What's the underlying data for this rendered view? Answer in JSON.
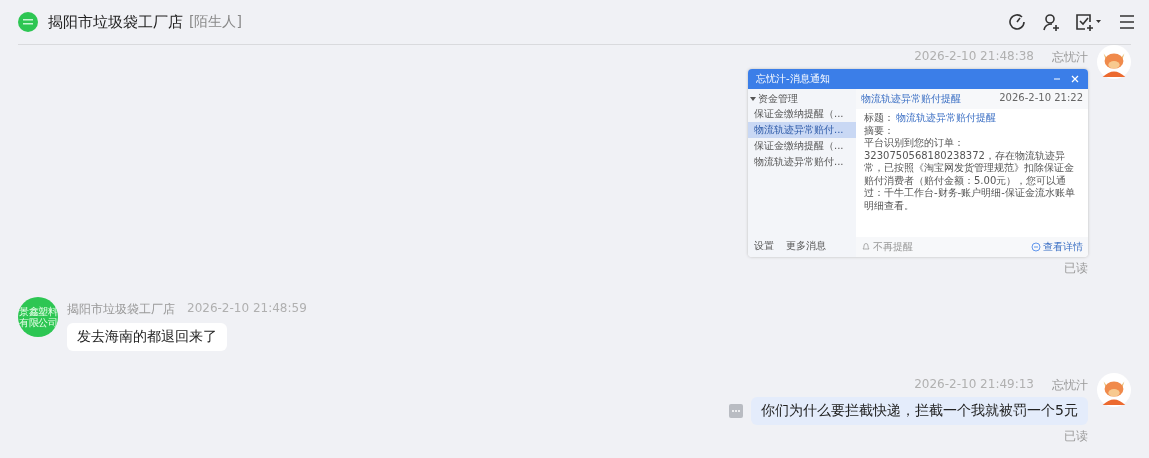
{
  "header": {
    "title": "揭阳市垃圾袋工厂店",
    "tag": "[陌生人]"
  },
  "messages": [
    {
      "outgoing": true,
      "kind": "screenshot",
      "sender": "忘忧汁",
      "time": "2026-2-10 21:48:38",
      "status": "已读",
      "screenshot": {
        "window_title": "忘忧汁-消息通知",
        "tree": {
          "label": "资金管理",
          "expanded": true,
          "children": [
            {
              "label": "保证金缴纳提醒（...",
              "selected": false
            },
            {
              "label": "物流轨迹异常赔付...",
              "selected": true
            },
            {
              "label": "保证金缴纳提醒（...",
              "selected": false
            },
            {
              "label": "物流轨迹异常赔付...",
              "selected": false
            }
          ]
        },
        "notice_title": "物流轨迹异常赔付提醒",
        "notice_time": "2026-2-10 21:22",
        "title_label": "标题：",
        "title_value": "物流轨迹异常赔付提醒",
        "summary_label": "摘要：",
        "summary": "平台识别到您的订单：3230750568180238372，存在物流轨迹异常，已按照《淘宝网发货管理规范》扣除保证金赔付消费者（赔付金额：5.00元），您可以通过：千牛工作台-财务-账户明细-保证金流水账单明细查看。",
        "footer_left": [
          "设置",
          "更多消息"
        ],
        "mute_label": "不再提醒",
        "details_link": "查看详情"
      }
    },
    {
      "outgoing": false,
      "kind": "text",
      "sender": "揭阳市垃圾袋工厂店",
      "time": "2026-2-10 21:48:59",
      "avatar_lines": [
        "景鑫塑料",
        "有限公司"
      ],
      "text": "发去海南的都退回来了"
    },
    {
      "outgoing": true,
      "kind": "text",
      "sender": "忘忧汁",
      "time": "2026-2-10 21:49:13",
      "status": "已读",
      "text": "你们为什么要拦截快递，拦截一个我就被罚一个5元"
    }
  ]
}
